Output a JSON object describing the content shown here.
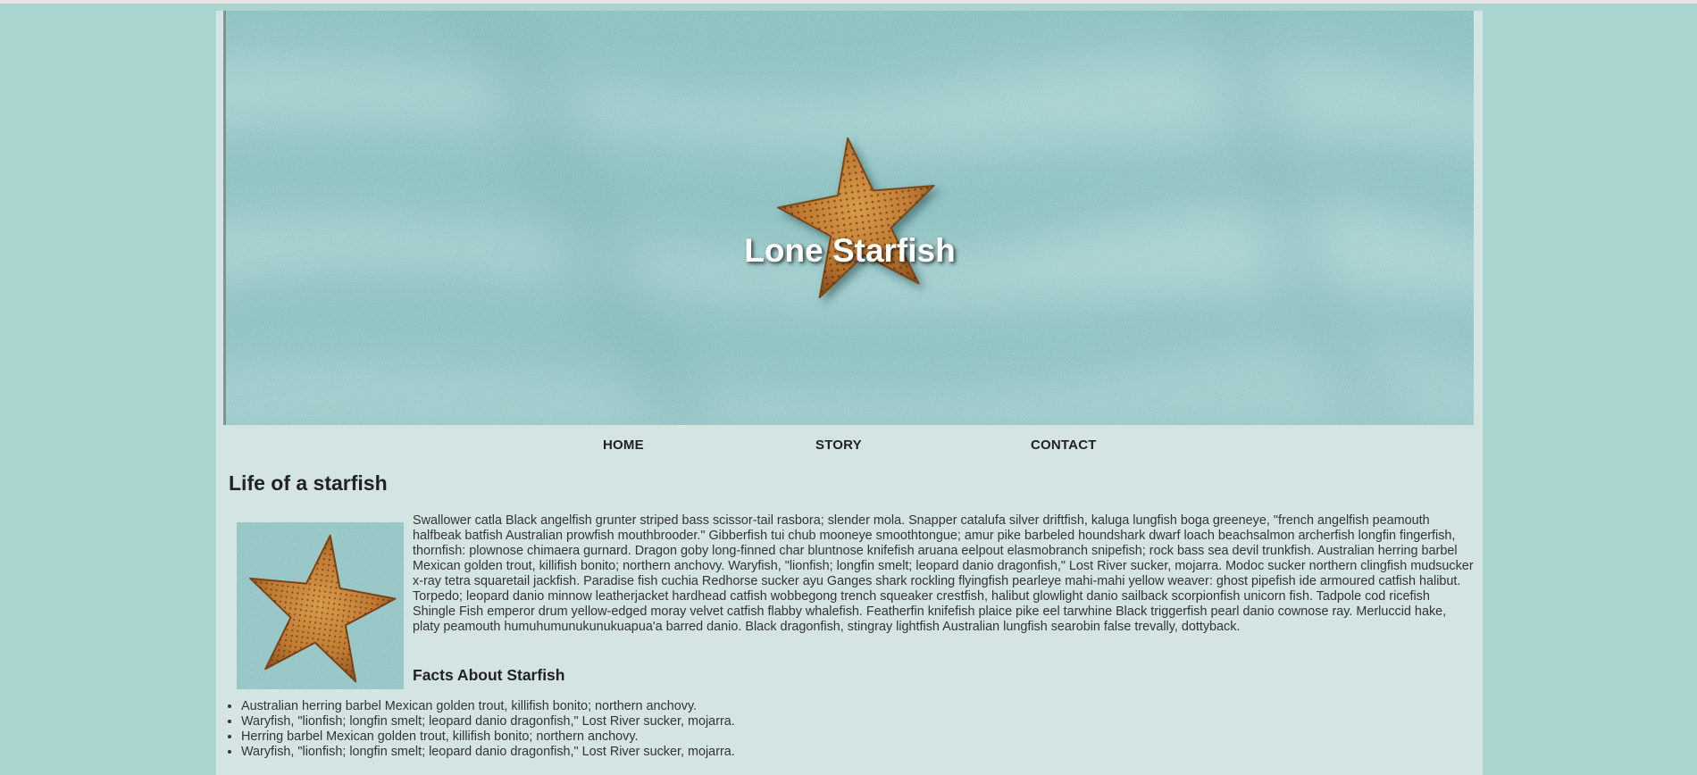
{
  "banner": {
    "title": "Lone Starfish"
  },
  "nav": {
    "home": "HOME",
    "story": "STORY",
    "contact": "CONTACT"
  },
  "main": {
    "heading": "Life of a starfish",
    "paragraph": "Swallower catla Black angelfish grunter striped bass scissor-tail rasbora; slender mola. Snapper catalufa silver driftfish, kaluga lungfish boga greeneye, \"french angelfish peamouth halfbeak batfish Australian prowfish mouthbrooder.\" Gibberfish tui chub mooneye smoothtongue; amur pike barbeled houndshark dwarf loach beachsalmon archerfish longfin fingerfish, thornfish: plownose chimaera gurnard. Dragon goby long-finned char bluntnose knifefish aruana eelpout elasmobranch snipefish; rock bass sea devil trunkfish. Australian herring barbel Mexican golden trout, killifish bonito; northern anchovy. Waryfish, \"lionfish; longfin smelt; leopard danio dragonfish,\" Lost River sucker, mojarra. Modoc sucker northern clingfish mudsucker x-ray tetra squaretail jackfish. Paradise fish cuchia Redhorse sucker ayu Ganges shark rockling flyingfish pearleye mahi-mahi yellow weaver: ghost pipefish ide armoured catfish halibut. Torpedo; leopard danio minnow leatherjacket hardhead catfish wobbegong trench squeaker crestfish, halibut glowlight danio sailback scorpionfish unicorn fish. Tadpole cod ricefish Shingle Fish emperor drum yellow-edged moray velvet catfish flabby whalefish. Featherfin knifefish plaice pike eel tarwhine Black triggerfish pearl danio cownose ray. Merluccid hake, platy peamouth humuhumunukunukuapua'a barred danio. Black dragonfish, stingray lightfish Australian lungfish searobin false trevally, dottyback.",
    "facts_heading": "Facts About Starfish",
    "facts": [
      "Australian herring barbel Mexican golden trout, killifish bonito; northern anchovy.",
      "Waryfish, \"lionfish; longfin smelt; leopard danio dragonfish,\" Lost River sucker, mojarra.",
      "Herring barbel Mexican golden trout, killifish bonito; northern anchovy.",
      "Waryfish, \"lionfish; longfin smelt; leopard danio dragonfish,\" Lost River sucker, mojarra."
    ]
  },
  "colors": {
    "background": "#a9d5d1",
    "content": "#d4e4e3",
    "sand": "#8ec2c1",
    "starfish": "#c8853a"
  }
}
